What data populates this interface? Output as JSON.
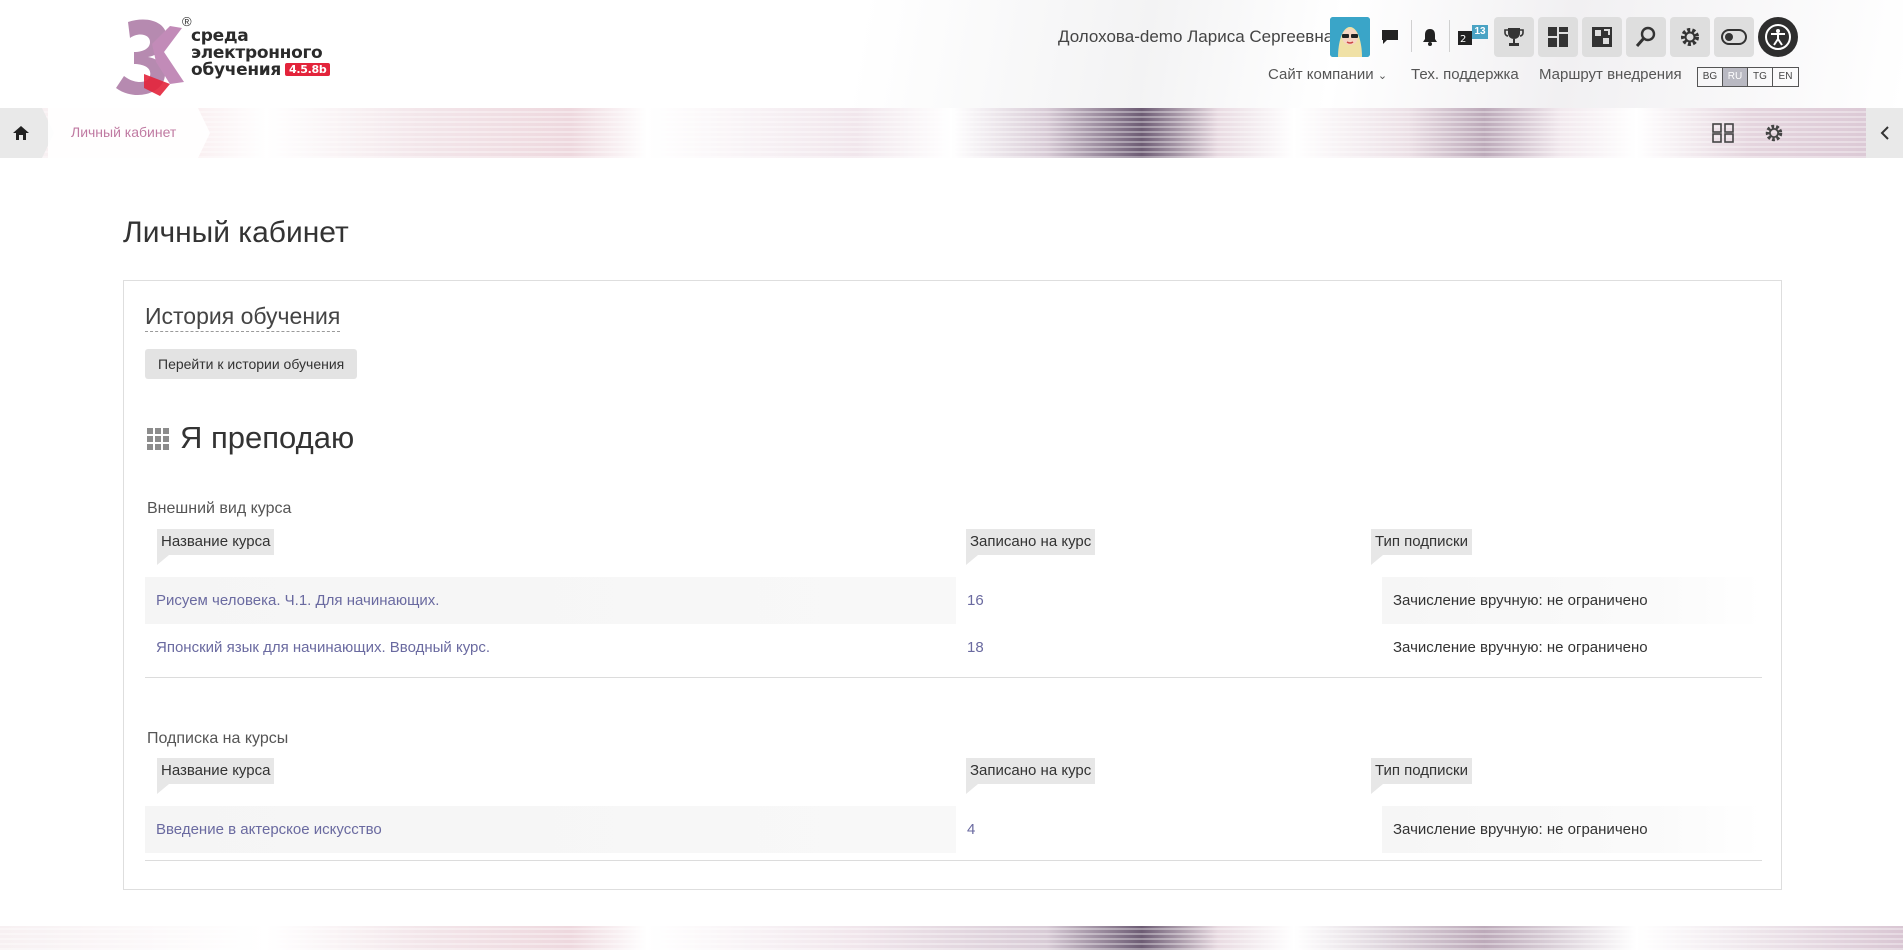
{
  "header": {
    "logo": {
      "reg_mark": "®",
      "line1": "среда",
      "line2": "электронного",
      "line3": "обучения",
      "version": "4.5.8b"
    },
    "user_name": "Долохова-demo Лариса Сергеевна",
    "notification_badge": "13",
    "nav": {
      "company_site": "Сайт компании",
      "support": "Тех. поддержка",
      "roadmap": "Маршрут внедрения"
    },
    "languages": [
      "BG",
      "RU",
      "TG",
      "EN"
    ],
    "active_language": "RU"
  },
  "breadcrumb": {
    "current": "Личный кабинет"
  },
  "page": {
    "title": "Личный кабинет",
    "history_title": "История обучения",
    "history_button": "Перейти к истории обучения",
    "teaching_title": "Я преподаю"
  },
  "blocks": [
    {
      "label": "Внешний вид курса",
      "headers": [
        "Название курса",
        "Записано на курс",
        "Тип подписки"
      ],
      "rows": [
        {
          "course": "Рисуем человека. Ч.1. Для начинающих.",
          "enrolled": "16",
          "subscription": "Зачисление вручную: не ограничено"
        },
        {
          "course": "Японский язык для начинающих. Вводный курс.",
          "enrolled": "18",
          "subscription": "Зачисление вручную: не ограничено"
        }
      ]
    },
    {
      "label": "Подписка на курсы",
      "headers": [
        "Название курса",
        "Записано на курс",
        "Тип подписки"
      ],
      "rows": [
        {
          "course": "Введение в актерское искусство",
          "enrolled": "4",
          "subscription": "Зачисление вручную: не ограничено"
        }
      ]
    }
  ],
  "colors": {
    "accent_pink": "#c07aa2",
    "link": "#6a6aa0",
    "badge": "#4aa3c4",
    "version_red": "#e3243b"
  }
}
